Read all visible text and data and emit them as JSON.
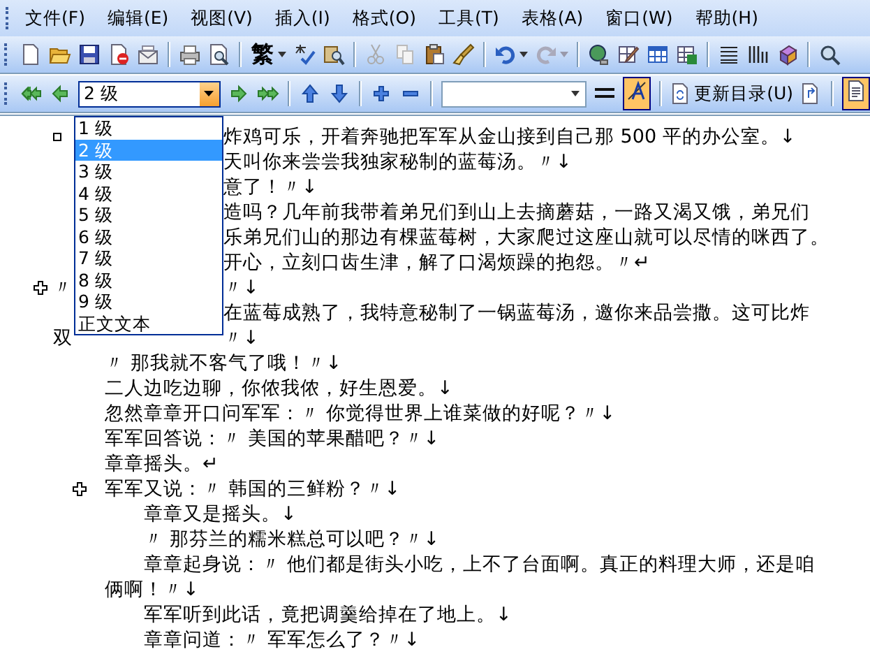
{
  "menu": [
    {
      "label": "文件(F)"
    },
    {
      "label": "编辑(E)"
    },
    {
      "label": "视图(V)"
    },
    {
      "label": "插入(I)"
    },
    {
      "label": "格式(O)"
    },
    {
      "label": "工具(T)"
    },
    {
      "label": "表格(A)"
    },
    {
      "label": "窗口(W)"
    },
    {
      "label": "帮助(H)"
    }
  ],
  "standard_toolbar": {
    "traditional_chinese_button": "繁"
  },
  "outlining_toolbar": {
    "level_combo": {
      "value": "2 级",
      "expanded": true
    },
    "show_formatting": {
      "on": true
    },
    "update_toc_button": "更新目录(U)",
    "outline_view": {
      "on": true
    }
  },
  "level_list": [
    {
      "label": "1 级",
      "selected": false
    },
    {
      "label": "2 级",
      "selected": true
    },
    {
      "label": "3 级",
      "selected": false
    },
    {
      "label": "4 级",
      "selected": false
    },
    {
      "label": "5 级",
      "selected": false
    },
    {
      "label": "6 级",
      "selected": false
    },
    {
      "label": "7 级",
      "selected": false
    },
    {
      "label": "8 级",
      "selected": false
    },
    {
      "label": "9 级",
      "selected": false
    },
    {
      "label": "正文文本",
      "selected": false
    }
  ],
  "document": {
    "lines": [
      {
        "kind": "clipped",
        "no_subtext": true,
        "text": "炸鸡可乐，开着奔驰把军军从金山接到自己那 500 平的办公室。↓"
      },
      {
        "kind": "clipped",
        "text": "天叫你来尝尝我独家秘制的蓝莓汤。〃↓"
      },
      {
        "kind": "clipped",
        "text": "意了！〃↓"
      },
      {
        "kind": "clipped",
        "text": "造吗？几年前我带着弟兄们到山上去摘蘑菇，一路又渴又饿，弟兄们"
      },
      {
        "kind": "clipped",
        "text": "乐弟兄们山的那边有棵蓝莓树，大家爬过这座山就可以尽情的咪西了。"
      },
      {
        "kind": "clipped",
        "text": "开心，立刻口齿生津，解了口渴烦躁的抱怨。〃↵"
      },
      {
        "kind": "clipped",
        "has_subtext": true,
        "left": "〃",
        "text": "〃↓"
      },
      {
        "kind": "clipped",
        "text": "在蓝莓成熟了，我特意秘制了一锅蓝莓汤，邀你来品尝撒。这可比炸"
      },
      {
        "kind": "clipped",
        "left": "双",
        "text": "〃↓"
      },
      {
        "kind": "body",
        "text": "〃 那我就不客气了哦！〃↓"
      },
      {
        "kind": "body",
        "text": "二人边吃边聊，你侬我侬，好生恩爱。↓"
      },
      {
        "kind": "body",
        "text": "忽然章章开口问军军：〃 你觉得世界上谁菜做的好呢？〃↓"
      },
      {
        "kind": "body",
        "text": "军军回答说：〃 美国的苹果醋吧？〃↓"
      },
      {
        "kind": "body",
        "text": "章章摇头。↵"
      },
      {
        "kind": "body",
        "has_subtext": true,
        "text": "军军又说：〃 韩国的三鲜粉？〃↓"
      },
      {
        "kind": "indent",
        "text": "章章又是摇头。↓"
      },
      {
        "kind": "indent",
        "text": "〃 那芬兰的糯米糕总可以吧？〃↓"
      },
      {
        "kind": "indent",
        "text": "章章起身说：〃 他们都是街头小吃，上不了台面啊。真正的料理大师，还是咱"
      },
      {
        "kind": "body",
        "text": "俩啊！〃↓"
      },
      {
        "kind": "indent",
        "text": "军军听到此话，竟把调羹给掉在了地上。↓"
      },
      {
        "kind": "indent",
        "text": "章章问道：〃 军军怎么了？〃↓"
      }
    ]
  }
}
